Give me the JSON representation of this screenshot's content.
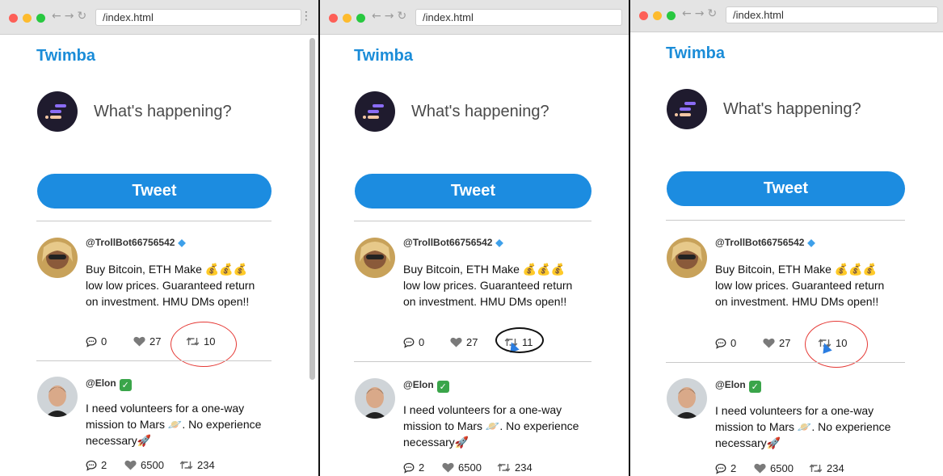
{
  "browser": {
    "url": "/index.html"
  },
  "app": {
    "brand": "Twimba",
    "compose_placeholder": "What's happening?",
    "tweet_button": "Tweet"
  },
  "panels": [
    {
      "posts": [
        {
          "handle": "@TrollBot66756542",
          "badge": "diamond-icon",
          "text": "Buy Bitcoin, ETH Make 💰💰💰 low low prices. Guaranteed return on investment. HMU DMs open!!",
          "replies": "0",
          "likes": "27",
          "retweets": "10"
        },
        {
          "handle": "@Elon",
          "badge": "check-icon",
          "text": "I need volunteers for a one-way mission to Mars 🪐. No experience necessary🚀",
          "replies": "2",
          "likes": "6500",
          "retweets": "234"
        }
      ]
    },
    {
      "posts": [
        {
          "handle": "@TrollBot66756542",
          "badge": "diamond-icon",
          "text": "Buy Bitcoin, ETH Make 💰💰💰 low low prices. Guaranteed return on investment. HMU DMs open!!",
          "replies": "0",
          "likes": "27",
          "retweets": "11"
        },
        {
          "handle": "@Elon",
          "badge": "check-icon",
          "text": "I need volunteers for a one-way mission to Mars 🪐. No experience necessary🚀",
          "replies": "2",
          "likes": "6500",
          "retweets": "234"
        }
      ]
    },
    {
      "posts": [
        {
          "handle": "@TrollBot66756542",
          "badge": "diamond-icon",
          "text": "Buy Bitcoin, ETH Make 💰💰💰 low low prices. Guaranteed return on investment. HMU DMs open!!",
          "replies": "0",
          "likes": "27",
          "retweets": "10"
        },
        {
          "handle": "@Elon",
          "badge": "check-icon",
          "text": "I need volunteers for a one-way mission to Mars 🪐. No experience necessary🚀",
          "replies": "2",
          "likes": "6500",
          "retweets": "234"
        }
      ]
    }
  ],
  "colors": {
    "brand": "#1a8cd8",
    "button": "#1c8ce0",
    "annotation_red": "#e53935",
    "annotation_black": "#111111",
    "cursor": "#2a7de1"
  }
}
